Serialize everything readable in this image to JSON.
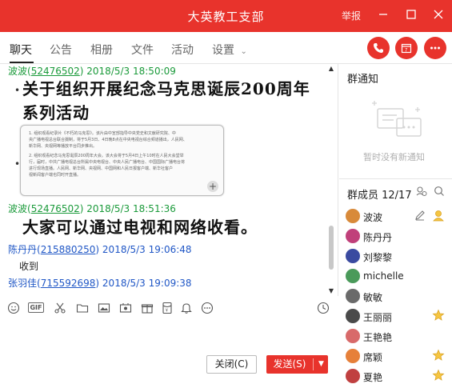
{
  "window": {
    "title": "大英教工支部",
    "report_label": "举报"
  },
  "tabs": [
    {
      "label": "聊天",
      "active": true
    },
    {
      "label": "公告"
    },
    {
      "label": "相册"
    },
    {
      "label": "文件"
    },
    {
      "label": "活动"
    },
    {
      "label": "设置"
    }
  ],
  "messages": [
    {
      "name": "波波",
      "uid": "52476502",
      "time": "2018/5/3 18:50:09",
      "color": "#1a9a3a",
      "text": "关于组织开展纪念马克思诞辰200周年系列活动"
    },
    {
      "name": "波波",
      "uid": "52476502",
      "time": "2018/5/3 18:51:36",
      "color": "#1a9a3a",
      "text": "大家可以通过电视和网络收看。"
    },
    {
      "name": "陈丹丹",
      "uid": "215880250",
      "time": "2018/5/3 19:06:48",
      "color": "#2057c6",
      "text": "收到"
    },
    {
      "name": "张羽佳",
      "uid": "715592698",
      "time": "2018/5/3 19:09:38",
      "color": "#2057c6",
      "text": ""
    }
  ],
  "image_lines": [
    "1. 组织观看纪录片《不朽的马克思》。该片由中宣部指导中央党史和文献研究院、中",
    "央广播电视总台联合摄制，将于5月3日、4日晚8点在中央电视台综合频道播出，人民网、",
    "新华网、央视网等播放平台同步推出。",
    "2. 组织观看纪念马克思诞辰200周年大会。该大会将于5月4日上午10时在人民大会堂举",
    "行，届时，中共广播电视总台所属中央电视台、中央人民广播电台、中国国际广播电台将",
    "进行现场直播。人民网、新华网、央视网、中国网和人民日报客户端、新华社客户",
    "视新闻客户端也同时开直播。"
  ],
  "buttons": {
    "close": "关闭(C)",
    "send": "发送(S)"
  },
  "right_panel": {
    "notice_title": "群通知",
    "notice_empty": "暂时没有新通知",
    "members_title": "群成员 12/17",
    "members": [
      {
        "name": "波波",
        "color": "#d88a3a",
        "badge": "edit"
      },
      {
        "name": "陈丹丹",
        "color": "#c0407a",
        "badge": ""
      },
      {
        "name": "刘黎黎",
        "color": "#3a4aa0",
        "badge": ""
      },
      {
        "name": "michelle",
        "color": "#4a9a5a",
        "badge": ""
      },
      {
        "name": "敏敏",
        "color": "#6a6a6a",
        "badge": ""
      },
      {
        "name": "王丽丽",
        "color": "#4a4a4a",
        "badge": "star"
      },
      {
        "name": "王艳艳",
        "color": "#d86a6a",
        "badge": ""
      },
      {
        "name": "席颖",
        "color": "#e6803a",
        "badge": "star"
      },
      {
        "name": "夏艳",
        "color": "#c04040",
        "badge": "star"
      }
    ]
  }
}
